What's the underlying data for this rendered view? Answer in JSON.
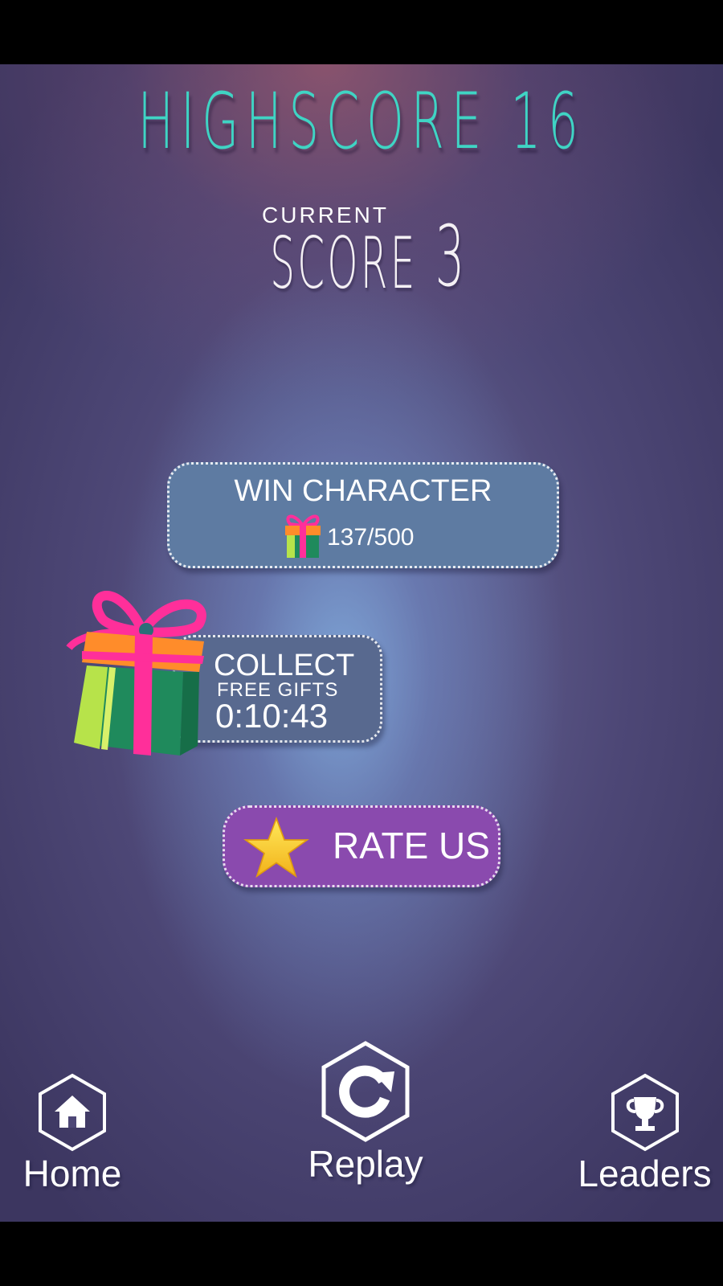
{
  "highscore": {
    "label": "HIGHSCORE",
    "value": "16",
    "color": "#3fd4c4"
  },
  "current_score": {
    "label_top": "CURRENT",
    "label_word": "SCORE",
    "value": "3"
  },
  "win_character": {
    "title": "WIN CHARACTER",
    "progress": "137/500",
    "icon": "gift-icon"
  },
  "collect": {
    "title": "COLLECT",
    "subtitle": "FREE GIFTS",
    "timer": "0:10:43",
    "icon": "gift-box-icon"
  },
  "rate": {
    "label": "RATE US",
    "icon": "star-icon",
    "color": "#8a4aae"
  },
  "nav": {
    "home": {
      "label": "Home",
      "icon": "home-icon"
    },
    "replay": {
      "label": "Replay",
      "icon": "replay-icon"
    },
    "leaders": {
      "label": "Leaders",
      "icon": "trophy-icon"
    }
  }
}
